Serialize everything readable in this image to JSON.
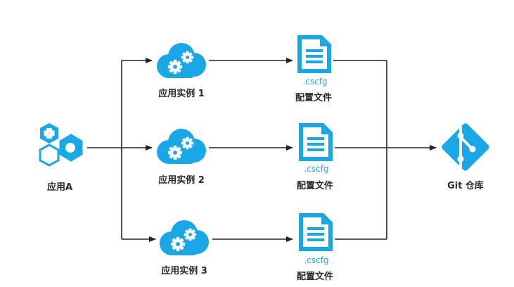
{
  "colors": {
    "accent": "#1aa7e6",
    "line": "#222222",
    "text": "#2b2b2b"
  },
  "source": {
    "label": "应用A",
    "icon": "hexagon-app-icon"
  },
  "instances": [
    {
      "label": "应用实例 1",
      "icon": "cloud-gears-icon",
      "config_ext": ".cscfg",
      "config_label": "配置文件",
      "config_icon": "document-icon"
    },
    {
      "label": "应用实例 2",
      "icon": "cloud-gears-icon",
      "config_ext": ".cscfg",
      "config_label": "配置文件",
      "config_icon": "document-icon"
    },
    {
      "label": "应用实例 3",
      "icon": "cloud-gears-icon",
      "config_ext": ".cscfg",
      "config_label": "配置文件",
      "config_icon": "document-icon"
    }
  ],
  "target": {
    "label": "Git 仓库",
    "icon": "git-icon"
  }
}
